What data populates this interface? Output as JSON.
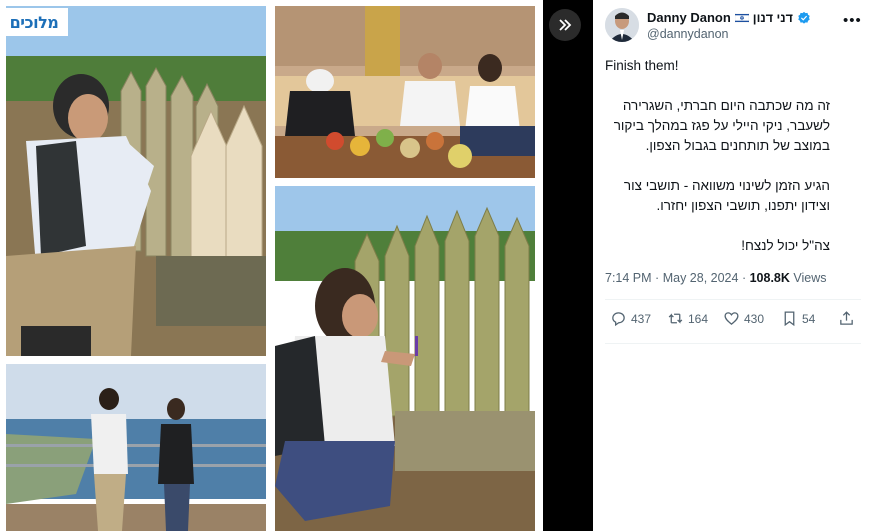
{
  "watermark": {
    "text": "מלוכים"
  },
  "lightbox": {
    "expand_icon": "double-chevron-right-icon"
  },
  "author": {
    "display_name": "Danny Danon",
    "hebrew_name": "דני דנון",
    "handle": "@dannydanon",
    "flag_icon": "israel-flag-icon",
    "verified_icon": "verified-badge-icon",
    "verified_color": "#1d9bf0"
  },
  "tweet": {
    "line1": "Finish them!",
    "para2": [
      "זה מה שכתבה היום חברתי, השגרירה",
      "לשעבר, ניקי היילי על פגז במהלך ביקור",
      "במוצב של תותחנים בגבול הצפון."
    ],
    "para3": [
      "הגיע הזמן לשינוי משוואה - תושבי צור",
      "וצידון יתפנו, תושבי הצפון יחזרו."
    ],
    "para4": [
      "צה\"ל יכול לנצח!"
    ]
  },
  "meta": {
    "time": "7:14 PM",
    "date": "May 28, 2024",
    "separator": "·",
    "views_count": "108.8K",
    "views_label": "Views"
  },
  "actions": {
    "replies": "437",
    "reposts": "164",
    "likes": "430",
    "bookmarks": "54"
  },
  "colors": {
    "text": "#0f1419",
    "secondary": "#536471",
    "accent": "#1d9bf0",
    "dark_panel": "#000000"
  }
}
